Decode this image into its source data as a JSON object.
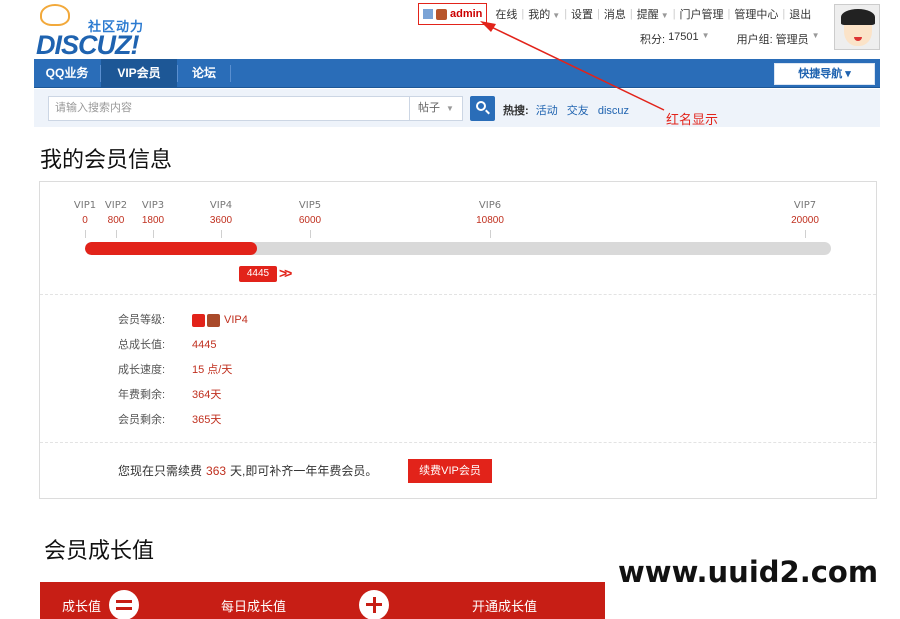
{
  "header": {
    "logo_tag": "社区动力",
    "logo_word": "DISCUZ!",
    "username": "admin",
    "nav": [
      "在线",
      "我的",
      "设置",
      "消息",
      "提醒",
      "门户管理",
      "管理中心",
      "退出"
    ],
    "credits_label": "积分:",
    "credits_value": "17501",
    "group_label": "用户组:",
    "group_value": "管理员"
  },
  "annotation": "红名显示",
  "navbar": {
    "items": [
      "QQ业务",
      "VIP会员",
      "论坛"
    ],
    "quick_nav": "快捷导航"
  },
  "search": {
    "placeholder": "请输入搜索内容",
    "type": "帖子",
    "hot_label": "热搜:",
    "hot_keywords": [
      "活动",
      "交友",
      "discuz"
    ]
  },
  "member_info": {
    "title": "我的会员信息",
    "levels": [
      {
        "name": "VIP1",
        "value": 0
      },
      {
        "name": "VIP2",
        "value": 800
      },
      {
        "name": "VIP3",
        "value": 1800
      },
      {
        "name": "VIP4",
        "value": 3600
      },
      {
        "name": "VIP5",
        "value": 6000
      },
      {
        "name": "VIP6",
        "value": 10800
      },
      {
        "name": "VIP7",
        "value": 20000
      }
    ],
    "current_value": "4445",
    "progress": 0.23,
    "rows": {
      "level_label": "会员等级:",
      "level_value": "VIP4",
      "total_label": "总成长值:",
      "total_value": "4445",
      "speed_label": "成长速度:",
      "speed_value": "15 点/天",
      "year_label": "年费剩余:",
      "year_value": "364天",
      "member_label": "会员剩余:",
      "member_value": "365天"
    },
    "renew_prefix": "您现在只需续费",
    "renew_days": "363",
    "renew_suffix": "天,即可补齐一年年费会员。",
    "renew_button": "续费VIP会员"
  },
  "growth": {
    "title": "会员成长值",
    "items": [
      "成长值",
      "每日成长值",
      "开通成长值"
    ]
  },
  "watermark": "www.uuid2.com",
  "colors": {
    "accent_red": "#e2231a",
    "nav_blue": "#2a6db8"
  }
}
